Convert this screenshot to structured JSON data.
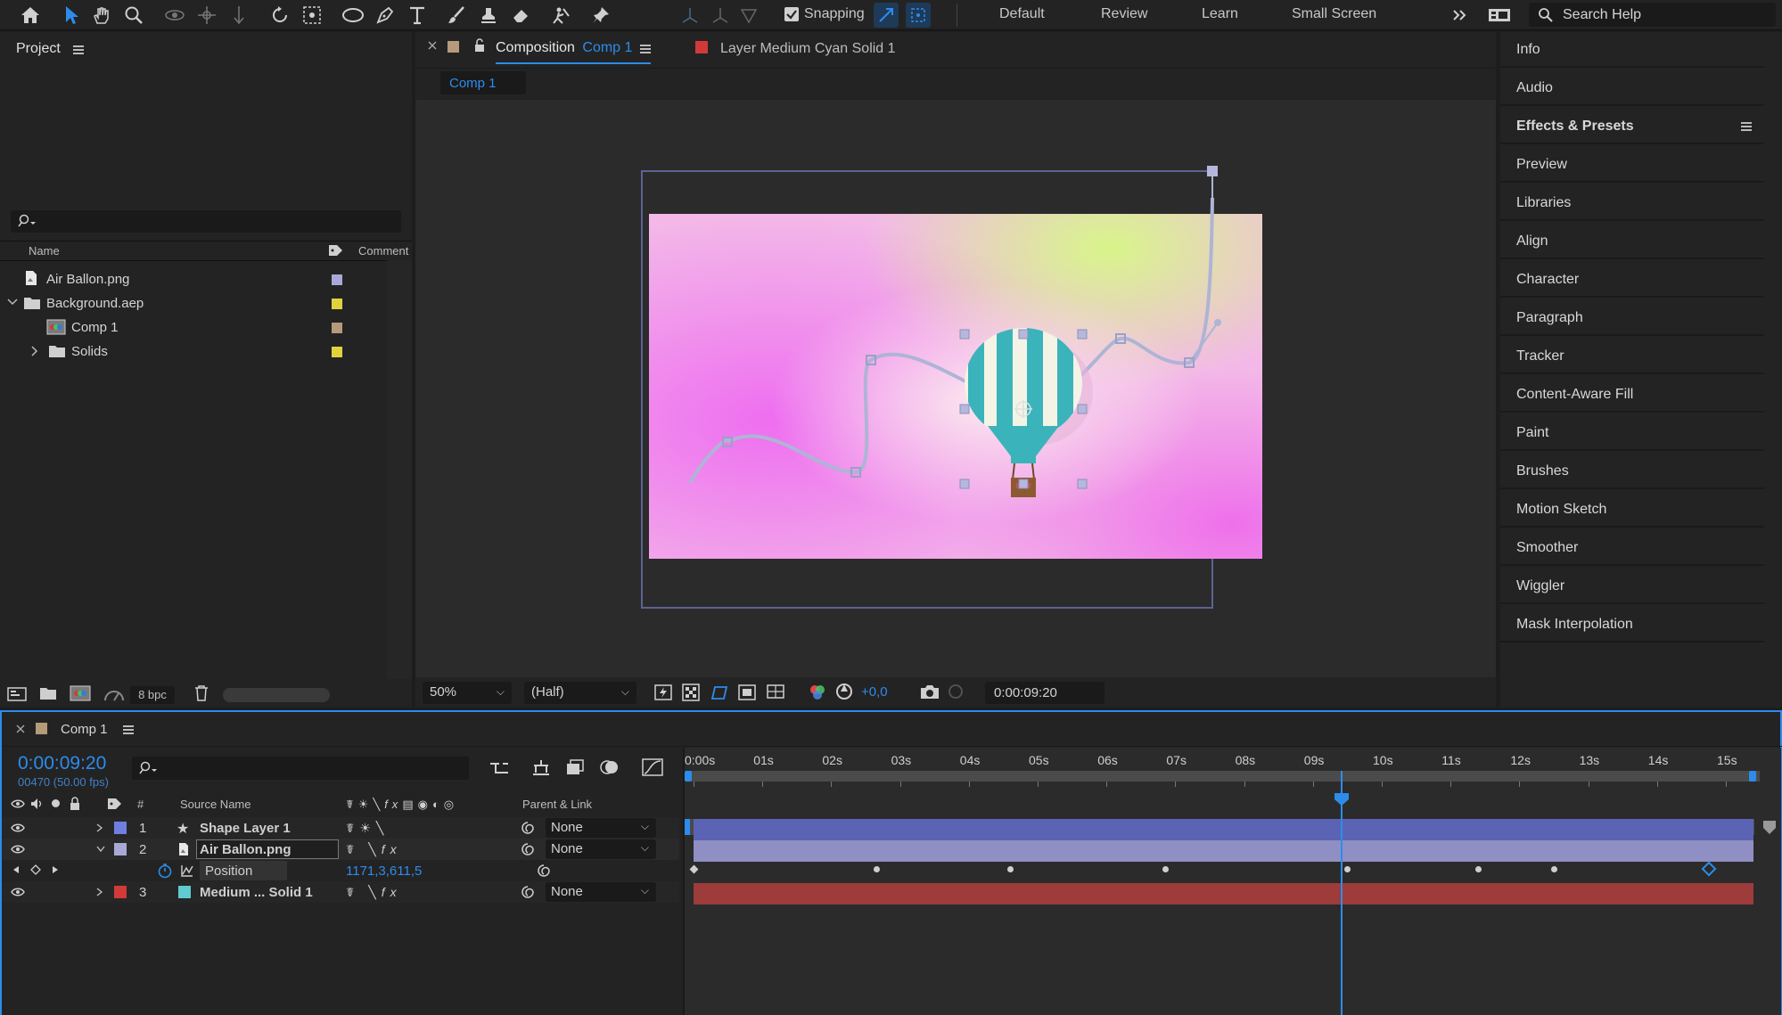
{
  "toolbar": {
    "snapping_label": "Snapping",
    "workspaces": [
      "Default",
      "Review",
      "Learn",
      "Small Screen"
    ],
    "search_placeholder": "Search Help",
    "accent": "#2d8ceb"
  },
  "project": {
    "title": "Project",
    "columns": {
      "name": "Name",
      "comment": "Comment"
    },
    "items": [
      {
        "label": "Air Ballon.png",
        "color": "#a9a9d8"
      },
      {
        "label": "Background.aep",
        "color": "#e2d13e"
      },
      {
        "label": "Comp 1",
        "color": "#b59b7a"
      },
      {
        "label": "Solids",
        "color": "#e2d13e"
      }
    ],
    "bpc": "8 bpc"
  },
  "composition": {
    "tab_prefix": "Composition",
    "tab_name": "Comp 1",
    "layer_tab": "Layer Medium Cyan Solid 1",
    "breadcrumb": "Comp 1",
    "zoom": "50%",
    "resolution": "(Half)",
    "exposure": "+0,0",
    "timecode": "0:00:09:20"
  },
  "right_panels": [
    "Info",
    "Audio",
    "Effects & Presets",
    "Preview",
    "Libraries",
    "Align",
    "Character",
    "Paragraph",
    "Tracker",
    "Content-Aware Fill",
    "Paint",
    "Brushes",
    "Motion Sketch",
    "Smoother",
    "Wiggler",
    "Mask Interpolation"
  ],
  "timeline": {
    "comp_name": "Comp 1",
    "timecode": "0:00:09:20",
    "frame_info": "00470 (50.00 fps)",
    "headers": {
      "num": "#",
      "source": "Source Name",
      "parent": "Parent & Link"
    },
    "ruler": [
      "0:00s",
      "01s",
      "02s",
      "03s",
      "04s",
      "05s",
      "06s",
      "07s",
      "08s",
      "09s",
      "10s",
      "11s",
      "12s",
      "13s",
      "14s",
      "15s"
    ],
    "layers": [
      {
        "num": "1",
        "name": "Shape Layer 1",
        "parent": "None",
        "label_color": "#6f7fe0",
        "bar_color": "#5a63b4"
      },
      {
        "num": "2",
        "name": "Air Ballon.png",
        "parent": "None",
        "label_color": "#a9a9d8",
        "bar_color": "#8f8fc4"
      },
      {
        "num": "3",
        "name": "Medium ... Solid 1",
        "parent": "None",
        "label_color": "#d23a3a",
        "bar_color": "#9e3b3b"
      }
    ],
    "property": {
      "name": "Position",
      "value": "1171,3,611,5"
    },
    "playhead_seconds": 9.4,
    "duration_seconds": 15.4
  }
}
